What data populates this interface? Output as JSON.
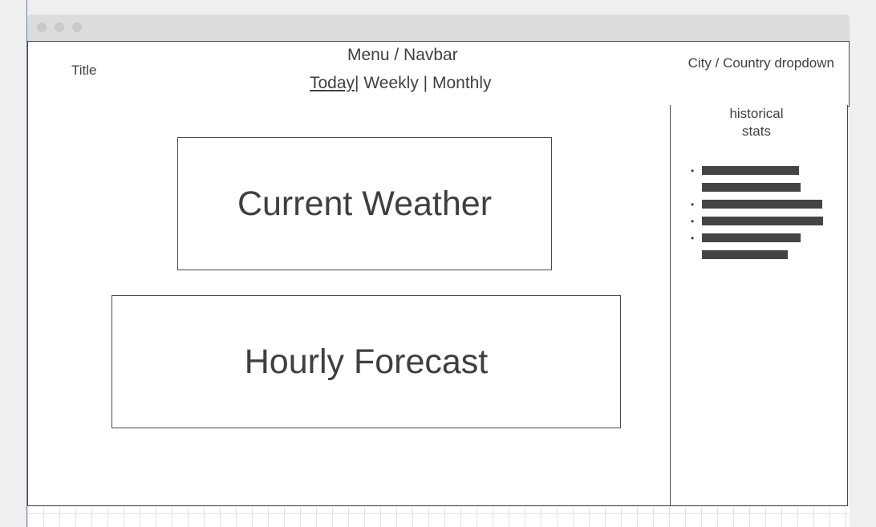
{
  "header": {
    "title": "Title",
    "menu_label": "Menu / Navbar",
    "nav": {
      "today": "Today",
      "separator_1": "|",
      "weekly": "Weekly",
      "separator_2": "|",
      "monthly": "Monthly"
    },
    "location_dropdown": "City / Country dropdown"
  },
  "main": {
    "current_weather": "Current Weather",
    "hourly_forecast": "Hourly Forecast"
  },
  "sidebar": {
    "title_line_1": "historical",
    "title_line_2": "stats"
  }
}
